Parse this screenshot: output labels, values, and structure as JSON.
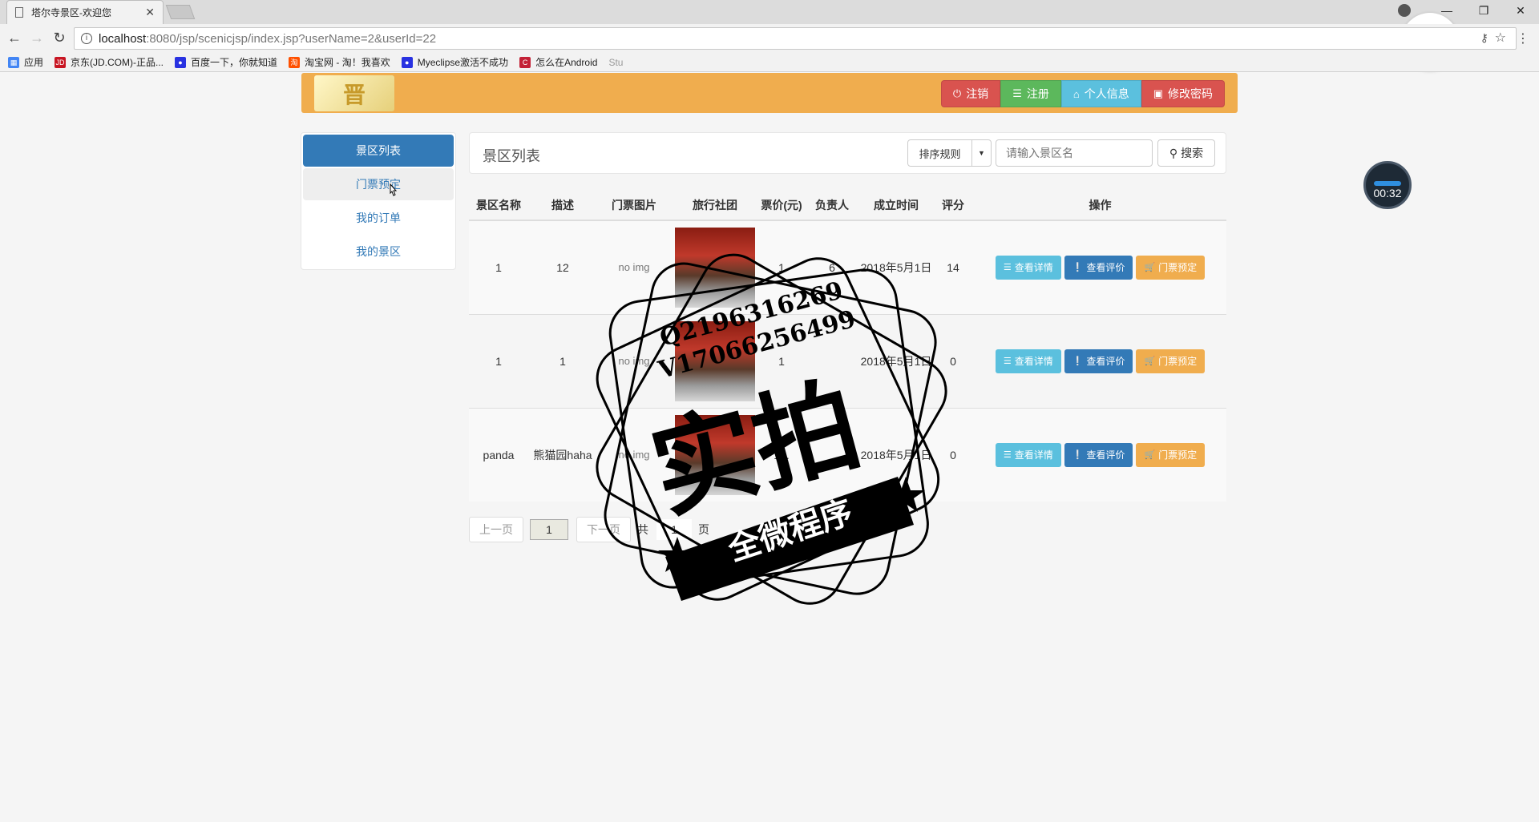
{
  "browser": {
    "tab_title": "塔尔寺景区-欢迎您",
    "tab_close": "✕",
    "url_host": "localhost",
    "url_rest": ":8080/jsp/scenicjsp/index.jsp?userName=2&userId=22",
    "bookmarks": [
      {
        "label": "应用",
        "icon": "apps-grid-icon",
        "color": "#4285f4"
      },
      {
        "label": "京东(JD.COM)-正品...",
        "icon": "jd-icon",
        "color": "#c81623"
      },
      {
        "label": "百度一下，你就知道",
        "icon": "baidu-paw-icon",
        "color": "#2932e1"
      },
      {
        "label": "淘宝网 - 淘！我喜欢",
        "icon": "taobao-icon",
        "color": "#ff5000"
      },
      {
        "label": "Myeclipse激活不成功",
        "icon": "baidu-paw-icon",
        "color": "#2932e1"
      },
      {
        "label": "怎么在Android",
        "icon": "csdn-icon",
        "color": "#c32136"
      },
      {
        "label": "Stu",
        "icon": "",
        "color": "#999999"
      }
    ]
  },
  "header": {
    "logo_text": "晋",
    "buttons": [
      {
        "label": "注销",
        "icon": "power-icon",
        "style": "red"
      },
      {
        "label": "注册",
        "icon": "list-icon",
        "style": "green"
      },
      {
        "label": "个人信息",
        "icon": "home-icon",
        "style": "cyan"
      },
      {
        "label": "修改密码",
        "icon": "lock-icon",
        "style": "red2"
      }
    ]
  },
  "sidebar": {
    "items": [
      {
        "label": "景区列表",
        "state": "active"
      },
      {
        "label": "门票预定",
        "state": "hover"
      },
      {
        "label": "我的订单",
        "state": "normal"
      },
      {
        "label": "我的景区",
        "state": "normal"
      }
    ]
  },
  "main": {
    "title": "景区列表",
    "sort_label": "排序规则",
    "search_placeholder": "请输入景区名",
    "search_button": "搜索",
    "columns": [
      "景区名称",
      "描述",
      "门票图片",
      "旅行社团",
      "票价(元)",
      "负责人",
      "成立时间",
      "评分",
      "操作"
    ],
    "rows": [
      {
        "name": "1",
        "desc": "12",
        "img": "no img",
        "price": "1",
        "manager": "6",
        "date": "2018年5月1日",
        "score": "14"
      },
      {
        "name": "1",
        "desc": "1",
        "img": "no img",
        "price": "1",
        "manager": "",
        "date": "2018年5月1日",
        "score": "0"
      },
      {
        "name": "panda",
        "desc": "熊猫园haha",
        "img": "no img",
        "price": "15.",
        "manager": "",
        "date": "2018年5月1日",
        "score": "0"
      }
    ],
    "actions": [
      {
        "label": "查看详情",
        "icon": "list-icon",
        "style": "info"
      },
      {
        "label": "查看评价",
        "icon": "info-circle-icon",
        "style": "primary"
      },
      {
        "label": "门票预定",
        "icon": "cart-icon",
        "style": "warning"
      }
    ]
  },
  "pager": {
    "prev": "上一页",
    "current": "1",
    "next": "下一页",
    "total_prefix": "共",
    "total": "1",
    "total_suffix": "页"
  },
  "overlay": {
    "recorder_time": "00:32",
    "stamp_line1": "Q2196316269",
    "stamp_line2": "V17066256499",
    "stamp_big": "实拍",
    "stamp_banner": "全微程序"
  }
}
